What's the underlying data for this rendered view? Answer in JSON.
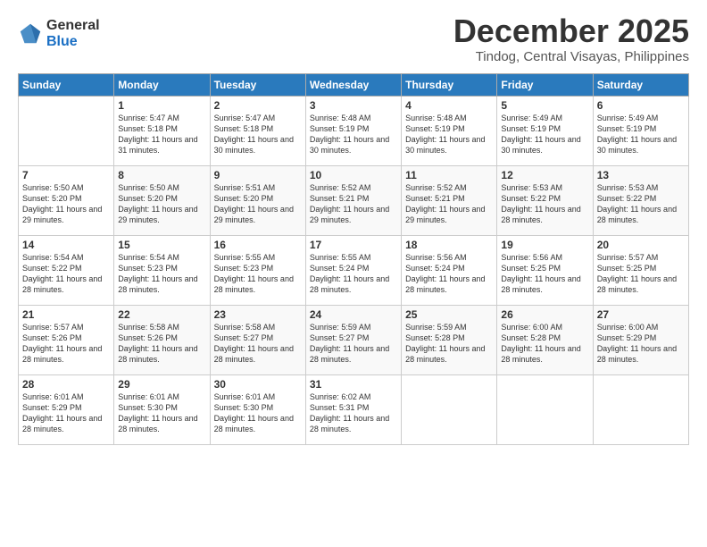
{
  "header": {
    "logo_general": "General",
    "logo_blue": "Blue",
    "month_title": "December 2025",
    "location": "Tindog, Central Visayas, Philippines"
  },
  "days_of_week": [
    "Sunday",
    "Monday",
    "Tuesday",
    "Wednesday",
    "Thursday",
    "Friday",
    "Saturday"
  ],
  "weeks": [
    [
      {
        "num": "",
        "sunrise": "",
        "sunset": "",
        "daylight": ""
      },
      {
        "num": "1",
        "sunrise": "Sunrise: 5:47 AM",
        "sunset": "Sunset: 5:18 PM",
        "daylight": "Daylight: 11 hours and 31 minutes."
      },
      {
        "num": "2",
        "sunrise": "Sunrise: 5:47 AM",
        "sunset": "Sunset: 5:18 PM",
        "daylight": "Daylight: 11 hours and 30 minutes."
      },
      {
        "num": "3",
        "sunrise": "Sunrise: 5:48 AM",
        "sunset": "Sunset: 5:19 PM",
        "daylight": "Daylight: 11 hours and 30 minutes."
      },
      {
        "num": "4",
        "sunrise": "Sunrise: 5:48 AM",
        "sunset": "Sunset: 5:19 PM",
        "daylight": "Daylight: 11 hours and 30 minutes."
      },
      {
        "num": "5",
        "sunrise": "Sunrise: 5:49 AM",
        "sunset": "Sunset: 5:19 PM",
        "daylight": "Daylight: 11 hours and 30 minutes."
      },
      {
        "num": "6",
        "sunrise": "Sunrise: 5:49 AM",
        "sunset": "Sunset: 5:19 PM",
        "daylight": "Daylight: 11 hours and 30 minutes."
      }
    ],
    [
      {
        "num": "7",
        "sunrise": "Sunrise: 5:50 AM",
        "sunset": "Sunset: 5:20 PM",
        "daylight": "Daylight: 11 hours and 29 minutes."
      },
      {
        "num": "8",
        "sunrise": "Sunrise: 5:50 AM",
        "sunset": "Sunset: 5:20 PM",
        "daylight": "Daylight: 11 hours and 29 minutes."
      },
      {
        "num": "9",
        "sunrise": "Sunrise: 5:51 AM",
        "sunset": "Sunset: 5:20 PM",
        "daylight": "Daylight: 11 hours and 29 minutes."
      },
      {
        "num": "10",
        "sunrise": "Sunrise: 5:52 AM",
        "sunset": "Sunset: 5:21 PM",
        "daylight": "Daylight: 11 hours and 29 minutes."
      },
      {
        "num": "11",
        "sunrise": "Sunrise: 5:52 AM",
        "sunset": "Sunset: 5:21 PM",
        "daylight": "Daylight: 11 hours and 29 minutes."
      },
      {
        "num": "12",
        "sunrise": "Sunrise: 5:53 AM",
        "sunset": "Sunset: 5:22 PM",
        "daylight": "Daylight: 11 hours and 28 minutes."
      },
      {
        "num": "13",
        "sunrise": "Sunrise: 5:53 AM",
        "sunset": "Sunset: 5:22 PM",
        "daylight": "Daylight: 11 hours and 28 minutes."
      }
    ],
    [
      {
        "num": "14",
        "sunrise": "Sunrise: 5:54 AM",
        "sunset": "Sunset: 5:22 PM",
        "daylight": "Daylight: 11 hours and 28 minutes."
      },
      {
        "num": "15",
        "sunrise": "Sunrise: 5:54 AM",
        "sunset": "Sunset: 5:23 PM",
        "daylight": "Daylight: 11 hours and 28 minutes."
      },
      {
        "num": "16",
        "sunrise": "Sunrise: 5:55 AM",
        "sunset": "Sunset: 5:23 PM",
        "daylight": "Daylight: 11 hours and 28 minutes."
      },
      {
        "num": "17",
        "sunrise": "Sunrise: 5:55 AM",
        "sunset": "Sunset: 5:24 PM",
        "daylight": "Daylight: 11 hours and 28 minutes."
      },
      {
        "num": "18",
        "sunrise": "Sunrise: 5:56 AM",
        "sunset": "Sunset: 5:24 PM",
        "daylight": "Daylight: 11 hours and 28 minutes."
      },
      {
        "num": "19",
        "sunrise": "Sunrise: 5:56 AM",
        "sunset": "Sunset: 5:25 PM",
        "daylight": "Daylight: 11 hours and 28 minutes."
      },
      {
        "num": "20",
        "sunrise": "Sunrise: 5:57 AM",
        "sunset": "Sunset: 5:25 PM",
        "daylight": "Daylight: 11 hours and 28 minutes."
      }
    ],
    [
      {
        "num": "21",
        "sunrise": "Sunrise: 5:57 AM",
        "sunset": "Sunset: 5:26 PM",
        "daylight": "Daylight: 11 hours and 28 minutes."
      },
      {
        "num": "22",
        "sunrise": "Sunrise: 5:58 AM",
        "sunset": "Sunset: 5:26 PM",
        "daylight": "Daylight: 11 hours and 28 minutes."
      },
      {
        "num": "23",
        "sunrise": "Sunrise: 5:58 AM",
        "sunset": "Sunset: 5:27 PM",
        "daylight": "Daylight: 11 hours and 28 minutes."
      },
      {
        "num": "24",
        "sunrise": "Sunrise: 5:59 AM",
        "sunset": "Sunset: 5:27 PM",
        "daylight": "Daylight: 11 hours and 28 minutes."
      },
      {
        "num": "25",
        "sunrise": "Sunrise: 5:59 AM",
        "sunset": "Sunset: 5:28 PM",
        "daylight": "Daylight: 11 hours and 28 minutes."
      },
      {
        "num": "26",
        "sunrise": "Sunrise: 6:00 AM",
        "sunset": "Sunset: 5:28 PM",
        "daylight": "Daylight: 11 hours and 28 minutes."
      },
      {
        "num": "27",
        "sunrise": "Sunrise: 6:00 AM",
        "sunset": "Sunset: 5:29 PM",
        "daylight": "Daylight: 11 hours and 28 minutes."
      }
    ],
    [
      {
        "num": "28",
        "sunrise": "Sunrise: 6:01 AM",
        "sunset": "Sunset: 5:29 PM",
        "daylight": "Daylight: 11 hours and 28 minutes."
      },
      {
        "num": "29",
        "sunrise": "Sunrise: 6:01 AM",
        "sunset": "Sunset: 5:30 PM",
        "daylight": "Daylight: 11 hours and 28 minutes."
      },
      {
        "num": "30",
        "sunrise": "Sunrise: 6:01 AM",
        "sunset": "Sunset: 5:30 PM",
        "daylight": "Daylight: 11 hours and 28 minutes."
      },
      {
        "num": "31",
        "sunrise": "Sunrise: 6:02 AM",
        "sunset": "Sunset: 5:31 PM",
        "daylight": "Daylight: 11 hours and 28 minutes."
      },
      {
        "num": "",
        "sunrise": "",
        "sunset": "",
        "daylight": ""
      },
      {
        "num": "",
        "sunrise": "",
        "sunset": "",
        "daylight": ""
      },
      {
        "num": "",
        "sunrise": "",
        "sunset": "",
        "daylight": ""
      }
    ]
  ]
}
